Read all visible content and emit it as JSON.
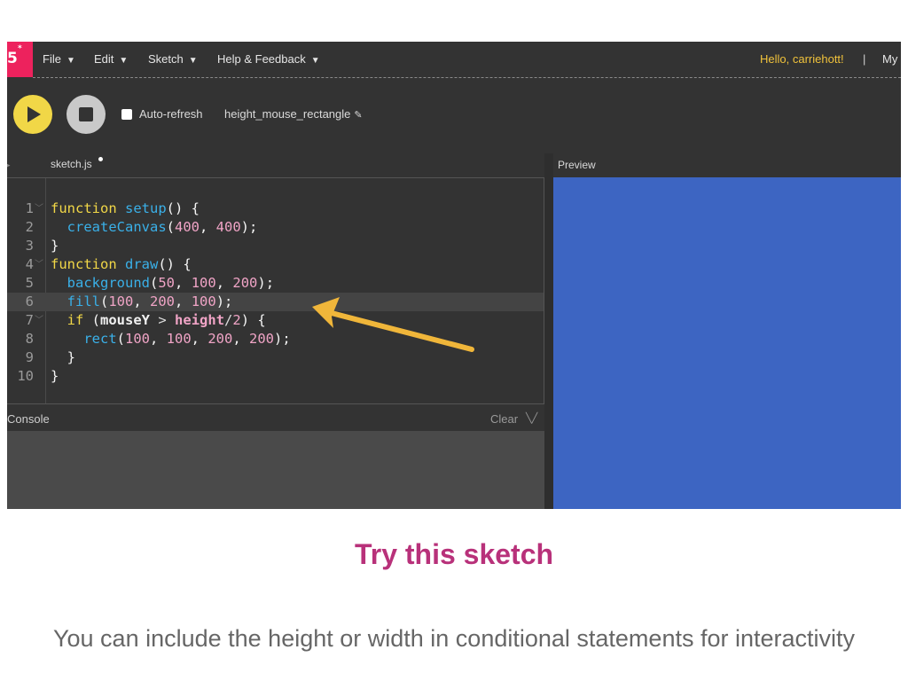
{
  "logo": {
    "text": "5",
    "sup": "*"
  },
  "menu": {
    "file": "File",
    "edit": "Edit",
    "sketch": "Sketch",
    "help": "Help & Feedback",
    "greeting": "Hello, carriehott!",
    "separator": "|",
    "my": "My"
  },
  "toolbar": {
    "auto_refresh": "Auto-refresh",
    "sketch_name": "height_mouse_rectangle"
  },
  "tab": {
    "filename": "sketch.js"
  },
  "code": {
    "line_numbers": [
      "1",
      "2",
      "3",
      "4",
      "5",
      "6",
      "7",
      "8",
      "9",
      "10"
    ]
  },
  "console": {
    "label": "Console",
    "clear": "Clear"
  },
  "preview": {
    "label": "Preview",
    "canvas_color": "#3d65c2"
  },
  "colors": {
    "brand": "#ed225d",
    "play": "#f1d747",
    "title": "#b8317a",
    "arrow": "#f0b63a"
  },
  "slide": {
    "title": "Try this sketch",
    "caption": "You can include the height or width in conditional statements for interactivity"
  }
}
